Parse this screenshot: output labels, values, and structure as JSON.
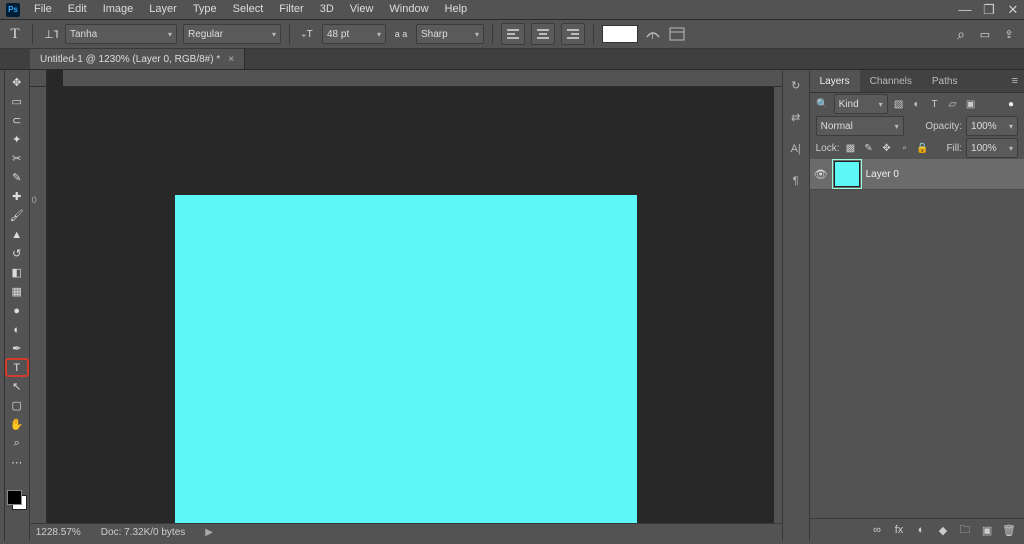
{
  "menubar": {
    "items": [
      "File",
      "Edit",
      "Image",
      "Layer",
      "Type",
      "Select",
      "Filter",
      "3D",
      "View",
      "Window",
      "Help"
    ]
  },
  "window_buttons": {
    "min": "—",
    "max": "❐",
    "close": "✕"
  },
  "optbar": {
    "tool_glyph": "T",
    "font_family": "Tanha",
    "font_style": "Regular",
    "font_size": "48 pt",
    "aa_label": "a a",
    "antialias": "Sharp"
  },
  "optbar_right": {
    "search": "⌕",
    "arrange": "▭",
    "share": "⇪"
  },
  "doc_tab": {
    "title": "Untitled-1 @ 1230% (Layer 0, RGB/8#) *",
    "close": "×"
  },
  "ruler": {
    "v_zero": "0"
  },
  "tools": [
    {
      "name": "move-tool",
      "g": "✥"
    },
    {
      "name": "marquee-tool",
      "g": "▭"
    },
    {
      "name": "lasso-tool",
      "g": "⊂"
    },
    {
      "name": "magic-wand-tool",
      "g": "✦"
    },
    {
      "name": "crop-tool",
      "g": "✂"
    },
    {
      "name": "eyedropper-tool",
      "g": "✎"
    },
    {
      "name": "healing-brush-tool",
      "g": "✚"
    },
    {
      "name": "brush-tool",
      "g": "🖌"
    },
    {
      "name": "clone-stamp-tool",
      "g": "▲"
    },
    {
      "name": "history-brush-tool",
      "g": "↺"
    },
    {
      "name": "eraser-tool",
      "g": "◧"
    },
    {
      "name": "gradient-tool",
      "g": "▦"
    },
    {
      "name": "blur-tool",
      "g": "●"
    },
    {
      "name": "dodge-tool",
      "g": "◐"
    },
    {
      "name": "pen-tool",
      "g": "✒"
    },
    {
      "name": "type-tool",
      "g": "T",
      "sel": true
    },
    {
      "name": "path-select-tool",
      "g": "↖"
    },
    {
      "name": "rectangle-tool",
      "g": "▢"
    },
    {
      "name": "hand-tool",
      "g": "✋"
    },
    {
      "name": "zoom-tool",
      "g": "⌕"
    },
    {
      "name": "more-tool",
      "g": "⋯"
    }
  ],
  "slim_icons": [
    {
      "name": "history-panel-icon",
      "g": "↻"
    },
    {
      "name": "properties-panel-icon",
      "g": "⇄"
    },
    {
      "name": "character-panel-icon",
      "g": "A|"
    },
    {
      "name": "paragraph-panel-icon",
      "g": "¶"
    }
  ],
  "panels": {
    "tabs": [
      "Layers",
      "Channels",
      "Paths"
    ],
    "active": "Layers",
    "filter": {
      "kind": "Kind"
    },
    "blend": {
      "mode": "Normal",
      "opacity_label": "Opacity:",
      "opacity": "100%"
    },
    "lock": {
      "label": "Lock:",
      "fill_label": "Fill:",
      "fill": "100%"
    },
    "layers": [
      {
        "name": "Layer 0"
      }
    ],
    "footer_icons": [
      "∞",
      "fx",
      "◐",
      "◆",
      "▣",
      "🗑"
    ]
  },
  "status": {
    "zoom": "1228.57%",
    "doc": "Doc: 7.32K/0 bytes",
    "arrow": "▶"
  },
  "colors": {
    "canvas": "#5df7f7"
  }
}
